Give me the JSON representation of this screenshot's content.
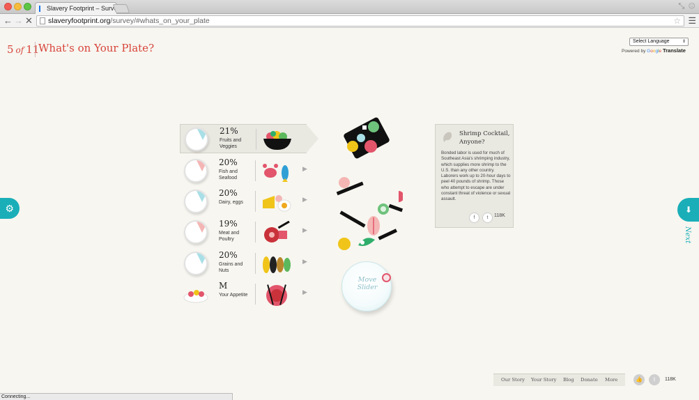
{
  "browser": {
    "tab_title": "Slavery Footprint – Survey",
    "url_host": "slaveryfootprint.org",
    "url_path": "/survey/#whats_on_your_plate",
    "status": "Connecting..."
  },
  "header": {
    "step_current": "5",
    "step_of": "of",
    "step_total": "11",
    "title": "What's on Your Plate?"
  },
  "translate": {
    "select_label": "Select Language",
    "powered_by": "Powered by",
    "google": [
      "G",
      "o",
      "o",
      "g",
      "l",
      "e"
    ],
    "translate_label": "Translate"
  },
  "side": {
    "settings_icon": "gear-icon",
    "next_icon": "arrow-down-icon",
    "next_label": "Next"
  },
  "categories": [
    {
      "percent": "21%",
      "label": "Fruits and Veggies",
      "wedge_color": "#a9dfe6",
      "fraction": 0.21,
      "icon": "salad-bowl-icon"
    },
    {
      "percent": "20%",
      "label": "Fish and Seafood",
      "wedge_color": "#f4b6b4",
      "fraction": 0.2,
      "icon": "crab-fish-icon"
    },
    {
      "percent": "20%",
      "label": "Dairy, eggs",
      "wedge_color": "#a9dfe6",
      "fraction": 0.2,
      "icon": "cheese-egg-icon"
    },
    {
      "percent": "19%",
      "label": "Meat and Poultry",
      "wedge_color": "#f4b6b4",
      "fraction": 0.19,
      "icon": "meat-knife-icon"
    },
    {
      "percent": "20%",
      "label": "Grains and Nuts",
      "wedge_color": "#a9dfe6",
      "fraction": 0.2,
      "icon": "grain-nut-icon"
    },
    {
      "percent": "M",
      "label": "Your Appetite",
      "wedge_color": "",
      "fraction": 0,
      "icon": "plate-cutlery-icon"
    }
  ],
  "slider": {
    "label_line1": "Move",
    "label_line2": "Slider"
  },
  "fact": {
    "title": "Shrimp Cocktail, Anyone?",
    "body": "Bonded labor is used for much of Southeast Asia's shrimping industry, which supplies more shrimp to the U.S. than any other country. Laborers work up to 20-hour days to peel 40 pounds of shrimp. Those who attempt to escape are under constant threat of violence or sexual assault.",
    "facebook": "f",
    "twitter": "t",
    "count": "118K"
  },
  "footer": {
    "links": [
      "Our Story",
      "Your Story",
      "Blog",
      "Donate",
      "More"
    ],
    "count": "118K"
  },
  "colors": {
    "accent_red": "#d8443b",
    "teal": "#1aaeb8",
    "background": "#f7f6f0"
  }
}
